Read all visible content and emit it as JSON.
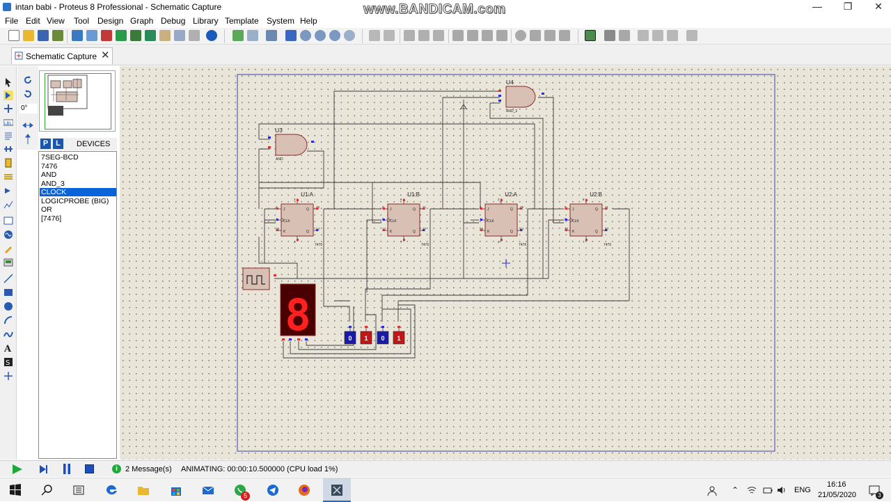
{
  "window": {
    "title": "intan babi - Proteus 8 Professional - Schematic Capture",
    "watermark": "www.BANDICAM.com",
    "minimize": "—",
    "maximize": "❐",
    "close": "✕"
  },
  "menu": [
    "File",
    "Edit",
    "View",
    "Tool",
    "Design",
    "Graph",
    "Debug",
    "Library",
    "Template",
    "System",
    "Help"
  ],
  "tab": {
    "label": "Schematic Capture",
    "close": "✕"
  },
  "rotation": {
    "angle": "0°"
  },
  "devices": {
    "p_label": "P",
    "l_label": "L",
    "title": "DEVICES",
    "items": [
      "7SEG-BCD",
      "7476",
      "AND",
      "AND_3",
      "CLOCK",
      "LOGICPROBE (BIG)",
      "OR",
      "[7476]"
    ],
    "selected": "CLOCK"
  },
  "schematic": {
    "gates": [
      {
        "ref": "U3",
        "type": "AND"
      },
      {
        "ref": "U4",
        "type": "AND_3"
      }
    ],
    "flipflops": [
      {
        "ref": "U1:A",
        "part": "7476",
        "pins": [
          "4",
          "1",
          "16",
          "3",
          "2",
          "15",
          "14"
        ],
        "j": "J",
        "k": "K",
        "clk": "CLK",
        "q": "Q",
        "qn": "Q"
      },
      {
        "ref": "U1:B",
        "part": "7476",
        "pins": [
          "9",
          "6",
          "12",
          "8",
          "7",
          "11",
          "10"
        ],
        "j": "J",
        "k": "K",
        "clk": "CLK",
        "q": "Q",
        "qn": "Q"
      },
      {
        "ref": "U2:A",
        "part": "7476",
        "pins": [
          "4",
          "1",
          "16",
          "3",
          "2",
          "15",
          "14"
        ],
        "j": "J",
        "k": "K",
        "clk": "CLK",
        "q": "Q",
        "qn": "Q"
      },
      {
        "ref": "U2:B",
        "part": "7476",
        "pins": [
          "9",
          "6",
          "12",
          "8",
          "7",
          "11",
          "10"
        ],
        "j": "J",
        "k": "K",
        "clk": "CLK",
        "q": "Q",
        "qn": "Q"
      }
    ],
    "display_digit": "8",
    "probes": [
      "0",
      "1",
      "0",
      "1"
    ],
    "colors": {
      "wire": "#3a3a3a",
      "part_fill": "#d8c0b4",
      "part_border": "#8a2a2a",
      "sheet_border": "#5a5ab8",
      "probe_low": "#1a1aa8",
      "probe_high": "#c01818",
      "seg_on": "#ff2020",
      "seg_bg": "#4a0000"
    }
  },
  "status": {
    "messages": "2 Message(s)",
    "animating": "ANIMATING: 00:00:10.500000 (CPU load 1%)"
  },
  "taskbar": {
    "lang": "ENG",
    "time": "16:16",
    "date": "21/05/2020",
    "whatsapp_badge": "5",
    "notif_badge": "3"
  }
}
